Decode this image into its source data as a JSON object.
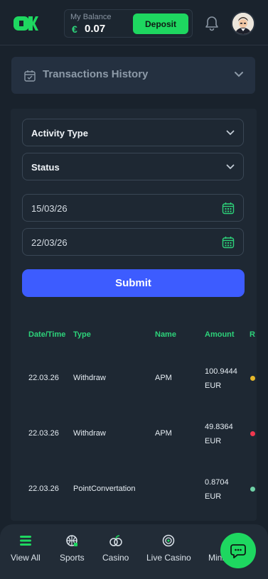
{
  "header": {
    "logo_text": "OK",
    "balance_label": "My Balance",
    "currency_symbol": "€",
    "balance_value": "0.07",
    "deposit_label": "Deposit"
  },
  "transactions": {
    "title": "Transactions History"
  },
  "filters": {
    "activity_type_label": "Activity Type",
    "status_label": "Status",
    "date_from": "15/03/26",
    "date_to": "22/03/26",
    "submit_label": "Submit"
  },
  "table": {
    "headers": [
      "Date/Time",
      "Type",
      "Name",
      "Amount",
      "R"
    ],
    "rows": [
      {
        "date": "22.03.26",
        "type": "Withdraw",
        "name": "APM",
        "amount_value": "100.9444",
        "amount_currency": "EUR",
        "status_color": "#e6b82a"
      },
      {
        "date": "22.03.26",
        "type": "Withdraw",
        "name": "APM",
        "amount_value": "49.8364",
        "amount_currency": "EUR",
        "status_color": "#f0384f"
      },
      {
        "date": "22.03.26",
        "type": "PointConvertation",
        "name": "",
        "amount_value": "0.8704",
        "amount_currency": "EUR",
        "status_color": "#6fd1a6"
      }
    ]
  },
  "bottom_nav": {
    "items": [
      {
        "label": "View All",
        "icon": "menu-icon"
      },
      {
        "label": "Sports",
        "icon": "sports-icon"
      },
      {
        "label": "Casino",
        "icon": "casino-icon"
      },
      {
        "label": "Live Casino",
        "icon": "live-casino-icon"
      },
      {
        "label": "Mini Games",
        "icon": "mini-games-icon"
      }
    ]
  },
  "colors": {
    "accent_green": "#1ed760",
    "submit_blue": "#3d5cff",
    "header_green_text": "#2dd27a",
    "background": "#19222c"
  }
}
